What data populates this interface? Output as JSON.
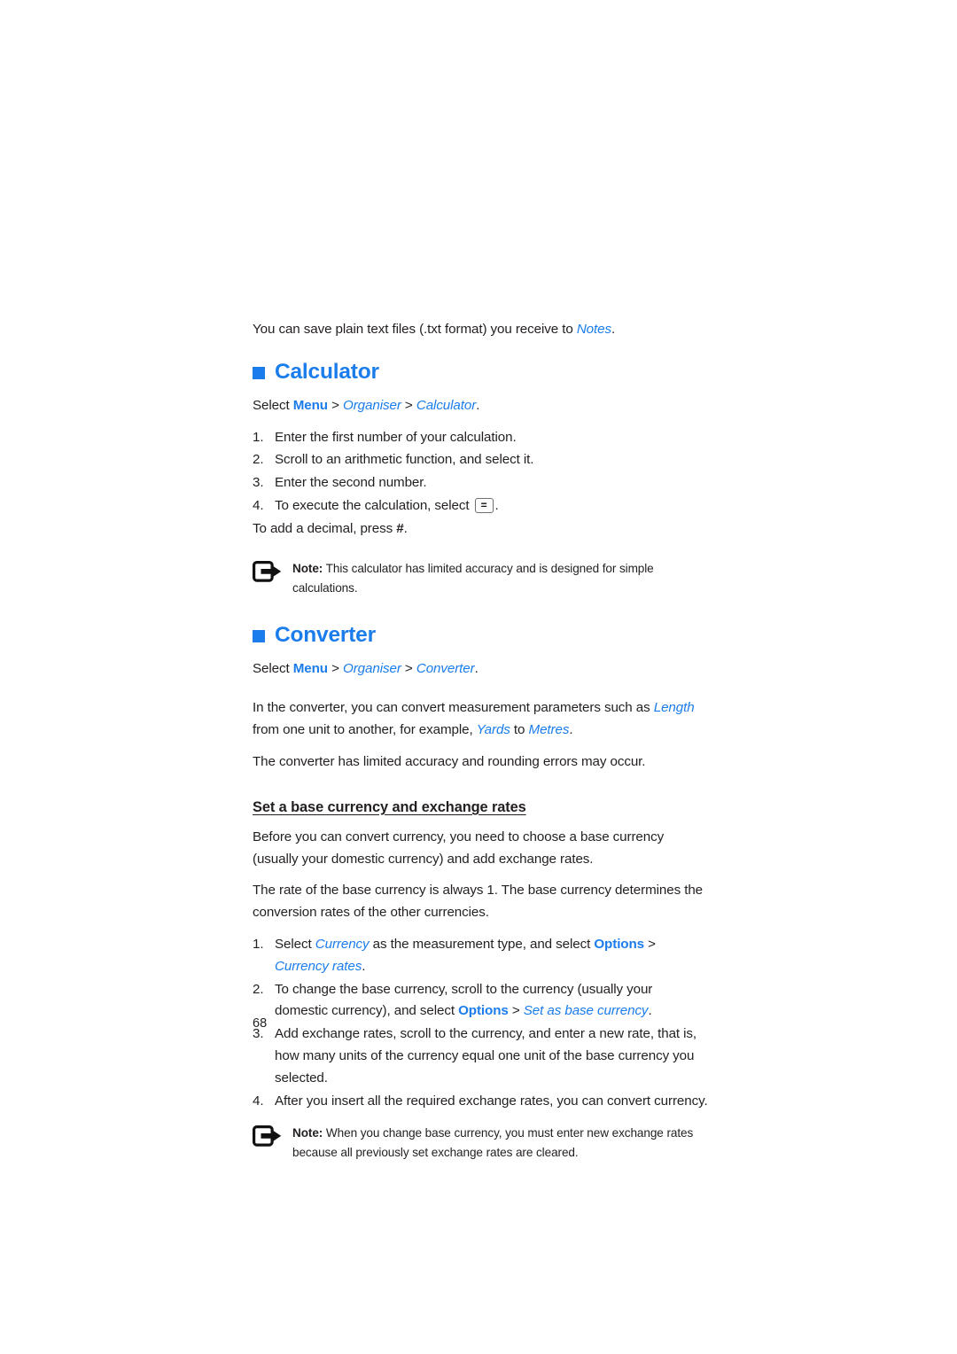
{
  "page": {
    "number": "68",
    "accent_color": "#1b7ceb",
    "text_color": "#231f20"
  },
  "intro": {
    "before": "You can save plain text files (.txt format) you receive to ",
    "link": "Notes",
    "after": "."
  },
  "calculator": {
    "heading": "Calculator",
    "path": {
      "select": "Select ",
      "menu": "Menu",
      "sep1": " > ",
      "organiser": "Organiser",
      "sep2": " > ",
      "target": "Calculator",
      "end": "."
    },
    "steps": [
      {
        "num": "1.",
        "text": "Enter the first number of your calculation."
      },
      {
        "num": "2.",
        "text": "Scroll to an arithmetic function, and select it."
      },
      {
        "num": "3.",
        "text": "Enter the second number."
      }
    ],
    "step4": {
      "num": "4.",
      "before": "To execute the calculation, select ",
      "key": "=",
      "after": "."
    },
    "decimal": {
      "before": "To add a decimal, press ",
      "key": "#",
      "after": "."
    },
    "note": {
      "icon": "note-arrow-icon",
      "label": "Note:",
      "text": " This calculator has limited accuracy and is designed for simple calculations."
    }
  },
  "converter": {
    "heading": "Converter",
    "path": {
      "select": "Select ",
      "menu": "Menu",
      "sep1": " > ",
      "organiser": "Organiser",
      "sep2": " > ",
      "target": "Converter",
      "end": "."
    },
    "intro": {
      "part1": "In the converter, you can convert measurement parameters such as ",
      "length": "Length",
      "part2": " from one unit to another, for example, ",
      "yards": "Yards",
      "part3": " to ",
      "metres": "Metres",
      "part4": "."
    },
    "accuracy": "The converter has limited accuracy and rounding errors may occur.",
    "subheading": "Set a base currency and exchange rates",
    "paragraphs": [
      "Before you can convert currency, you need to choose a base currency (usually your domestic currency) and add exchange rates.",
      "The rate of the base currency is always 1. The base currency determines the conversion rates of the other currencies."
    ],
    "steps": {
      "one": {
        "num": "1.",
        "part1": "Select ",
        "currency": "Currency",
        "part2": " as the measurement type, and select ",
        "options": "Options",
        "sep": " > ",
        "currency_rates": "Currency rates",
        "end": "."
      },
      "two": {
        "num": "2.",
        "part1": "To change the base currency, scroll to the currency (usually your domestic currency), and select ",
        "options": "Options",
        "sep": " > ",
        "set_as_base": "Set as base currency",
        "end": "."
      },
      "three": {
        "num": "3.",
        "text": "Add exchange rates, scroll to the currency, and enter a new rate, that is, how many units of the currency equal one unit of the base currency you selected."
      },
      "four": {
        "num": "4.",
        "text": "After you insert all the required exchange rates, you can convert currency."
      }
    },
    "note": {
      "icon": "note-arrow-icon",
      "label": "Note:",
      "text": " When you change base currency, you must enter new exchange rates because all previously set exchange rates are cleared."
    }
  }
}
